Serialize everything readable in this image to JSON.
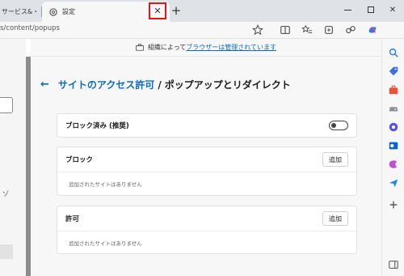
{
  "tabs": [
    {
      "label": "サービス&・"
    },
    {
      "label": "設定"
    }
  ],
  "address": {
    "url": "s/content/popups"
  },
  "banner": {
    "prefix": "組織によって",
    "link": "ブラウザーは管理されています"
  },
  "page": {
    "breadcrumb": "サイトのアクセス許可",
    "separator": "/",
    "title": "ポップアップとリダイレクト"
  },
  "settings": {
    "block_toggle": {
      "label": "ブロック済み (推奨)",
      "on": false
    },
    "block_section": {
      "title": "ブロック",
      "add_label": "追加",
      "empty_text": "追加されたサイトはありません"
    },
    "allow_section": {
      "title": "許可",
      "add_label": "追加",
      "empty_text": "追加されたサイトはありません"
    }
  },
  "left_nav": {
    "glyph": "ゾ"
  },
  "colors": {
    "accent": "#0f6cbd",
    "highlight_box": "#ee1111"
  }
}
